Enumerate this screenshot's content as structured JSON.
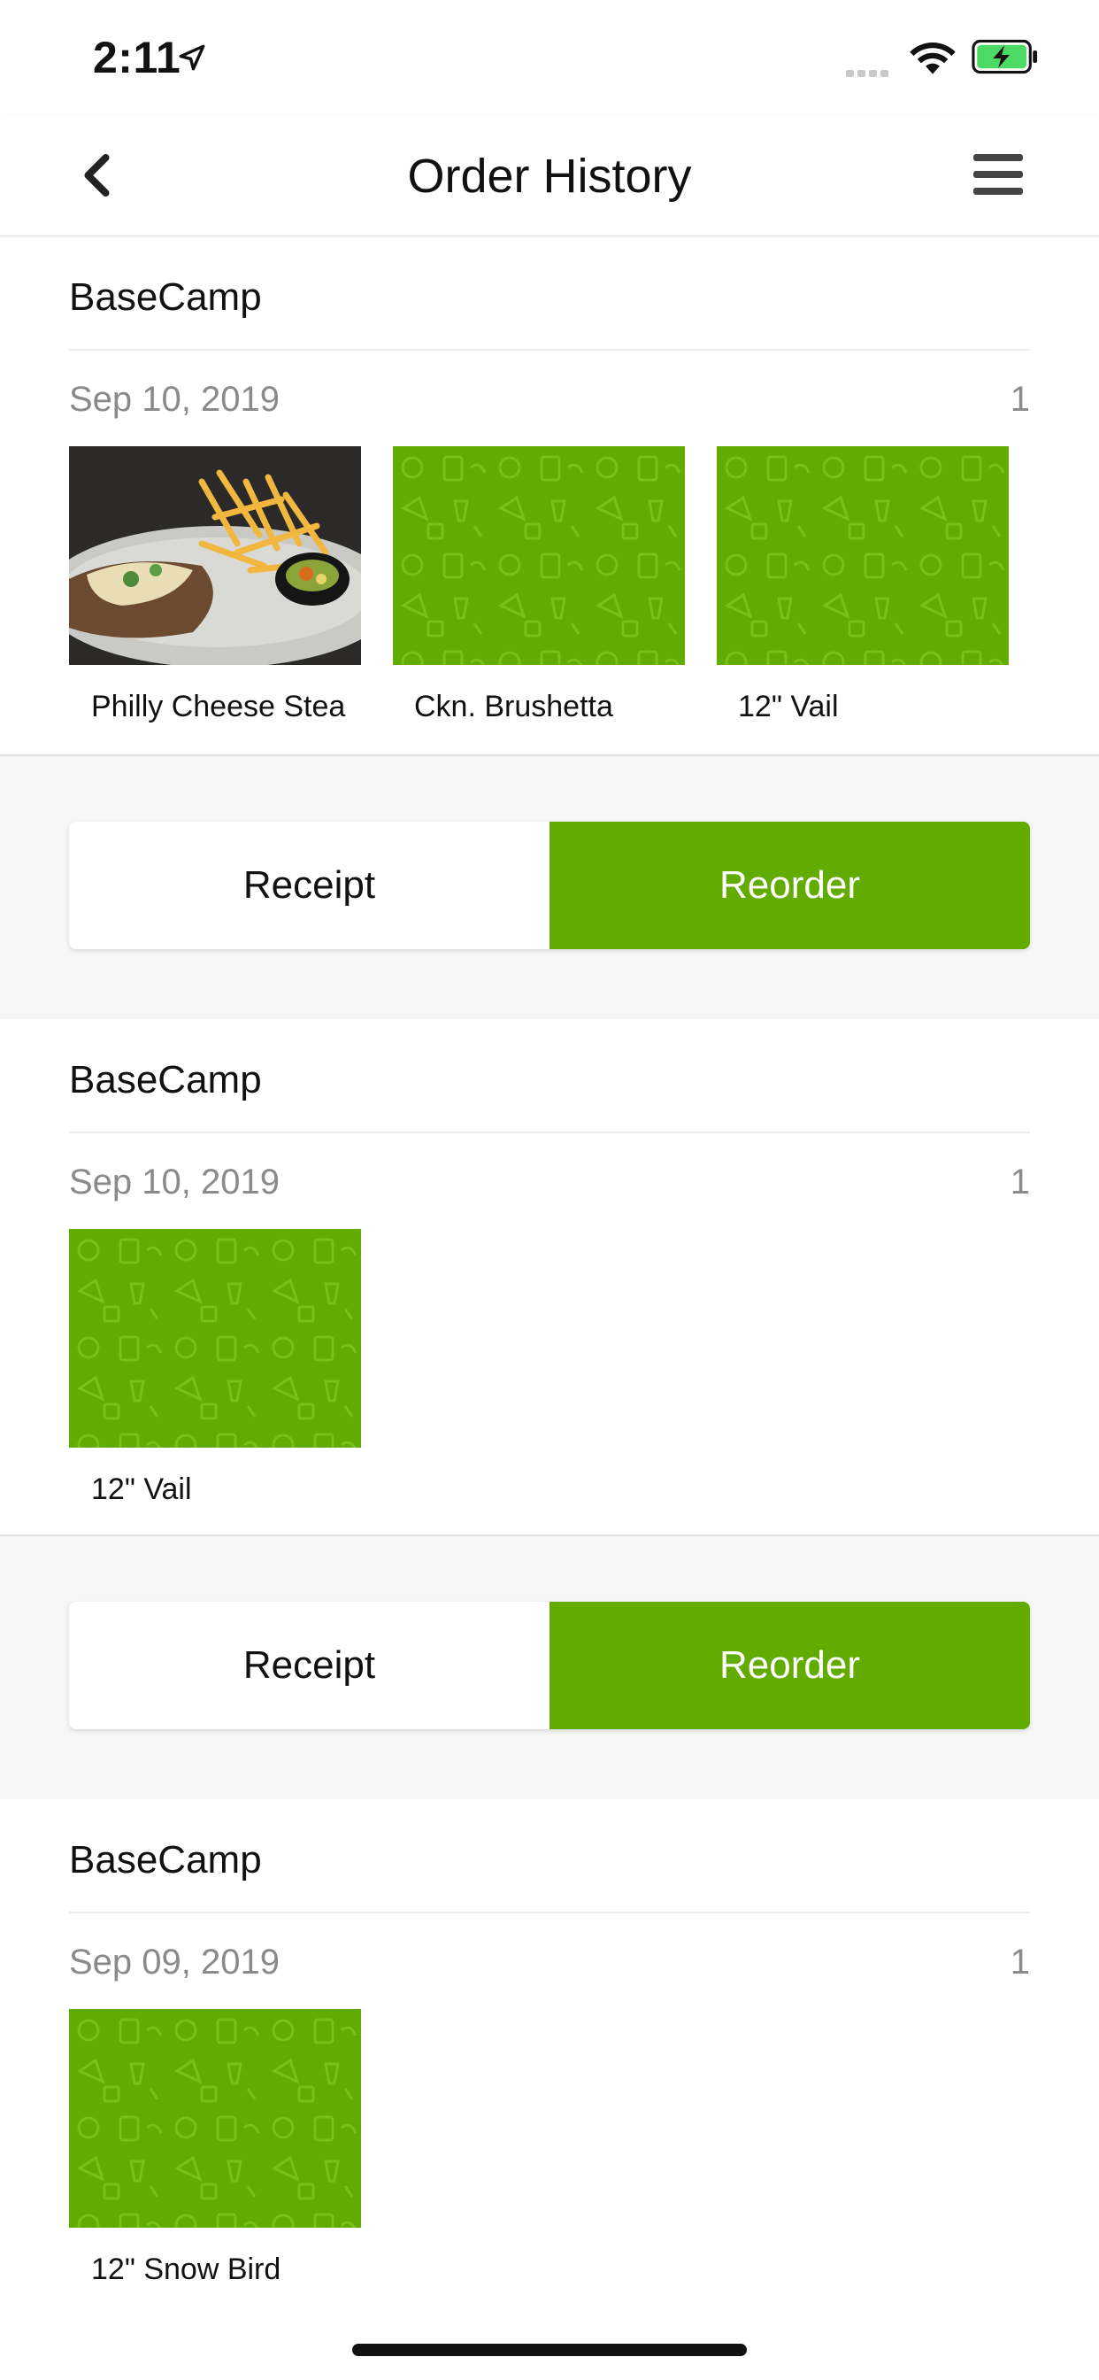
{
  "status_bar": {
    "time": "2:11"
  },
  "header": {
    "title": "Order History"
  },
  "colors": {
    "accent": "#62ab00",
    "muted_text": "#8a8a8a"
  },
  "orders": [
    {
      "restaurant": "BaseCamp",
      "date": "Sep 10, 2019",
      "count": "1",
      "items": [
        {
          "label": "Philly Cheese Stea",
          "image": "photo"
        },
        {
          "label": "Ckn. Brushetta",
          "image": "placeholder"
        },
        {
          "label": "12\" Vail",
          "image": "placeholder"
        }
      ],
      "receipt_label": "Receipt",
      "reorder_label": "Reorder"
    },
    {
      "restaurant": "BaseCamp",
      "date": "Sep 10, 2019",
      "count": "1",
      "items": [
        {
          "label": "12\" Vail",
          "image": "placeholder"
        }
      ],
      "receipt_label": "Receipt",
      "reorder_label": "Reorder"
    },
    {
      "restaurant": "BaseCamp",
      "date": "Sep 09, 2019",
      "count": "1",
      "items": [
        {
          "label": "12\" Snow Bird",
          "image": "placeholder"
        }
      ]
    }
  ]
}
